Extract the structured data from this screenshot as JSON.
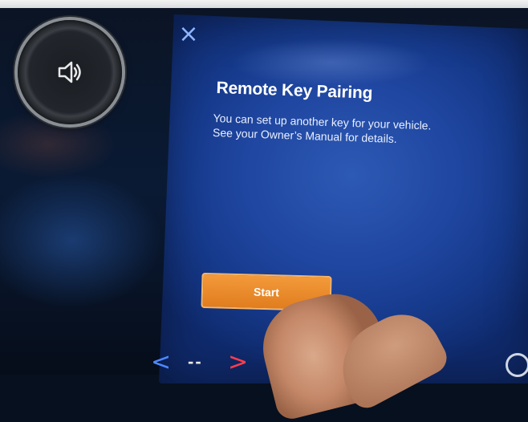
{
  "dialog": {
    "close_symbol": "×",
    "title": "Remote Key Pairing",
    "description_line1": "You can set up another key for your vehicle.",
    "description_line2": "See your Owner’s Manual for details.",
    "start_label": "Start"
  },
  "nav": {
    "left_symbol": "<",
    "center_symbol": "--",
    "right_symbol": ">"
  },
  "icons": {
    "volume": "speaker-icon",
    "close": "close-icon",
    "nav_left": "chevron-left-icon",
    "nav_right": "chevron-right-icon",
    "corner": "circle-icon"
  },
  "colors": {
    "screen_blue": "#1f46a0",
    "start_orange": "#e07d1f",
    "close_blue": "#8fb6ff",
    "nav_left_blue": "#4e88ff",
    "nav_right_red": "#ff3d4d"
  }
}
